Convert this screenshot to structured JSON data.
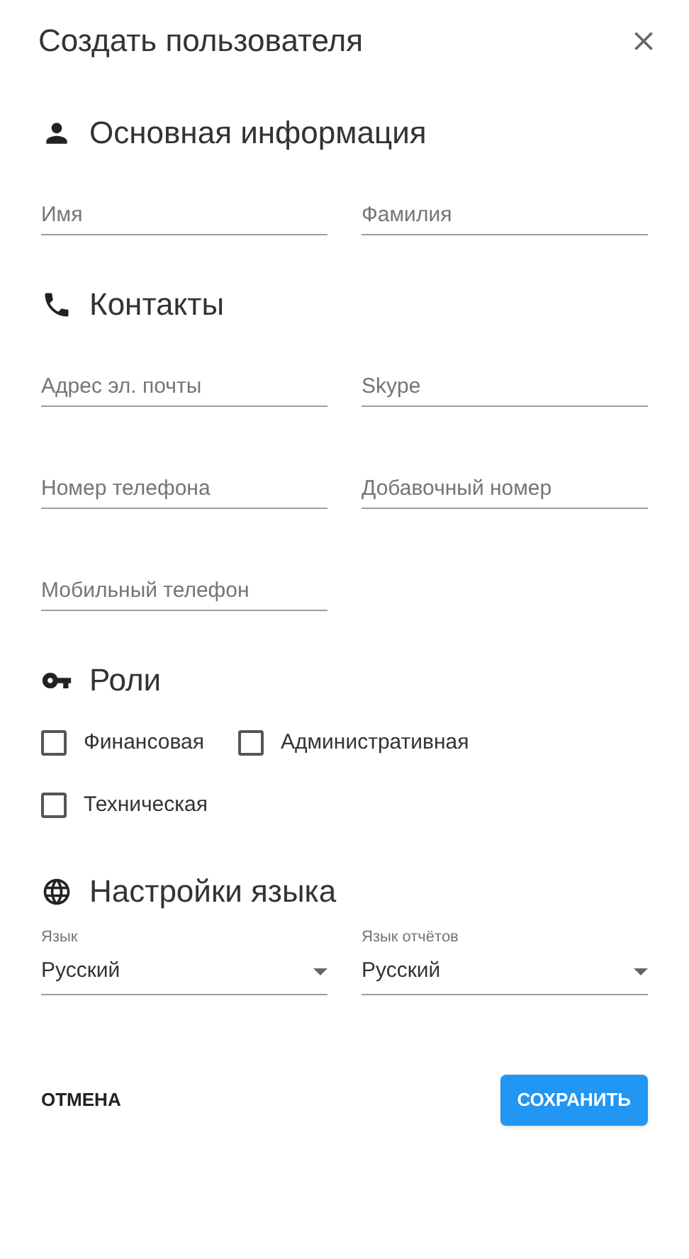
{
  "dialog": {
    "title": "Создать пользователя"
  },
  "sections": [
    {
      "kind": "fields",
      "title": "Основная информация",
      "fields": [
        {
          "placeholder": "Имя"
        },
        {
          "placeholder": "Фамилия"
        }
      ]
    },
    {
      "kind": "fields",
      "title": "Контакты",
      "fields": [
        {
          "placeholder": "Адрес эл. почты"
        },
        {
          "placeholder": "Skype"
        },
        {
          "placeholder": "Номер телефона"
        },
        {
          "placeholder": "Добавочный номер"
        },
        {
          "placeholder": "Мобильный телефон"
        }
      ]
    },
    {
      "kind": "checkboxes",
      "title": "Роли",
      "options": [
        {
          "label": "Финансовая",
          "checked": false
        },
        {
          "label": "Административная",
          "checked": false
        },
        {
          "label": "Техническая",
          "checked": false
        }
      ]
    },
    {
      "kind": "selects",
      "title": "Настройки языка",
      "selects": [
        {
          "label": "Язык",
          "value": "Русский"
        },
        {
          "label": "Язык отчётов",
          "value": "Русский"
        }
      ]
    }
  ],
  "buttons": [
    {
      "kind": "text",
      "label": "ОТМЕНА"
    },
    {
      "kind": "primary",
      "label": "СОХРАНИТЬ"
    }
  ]
}
